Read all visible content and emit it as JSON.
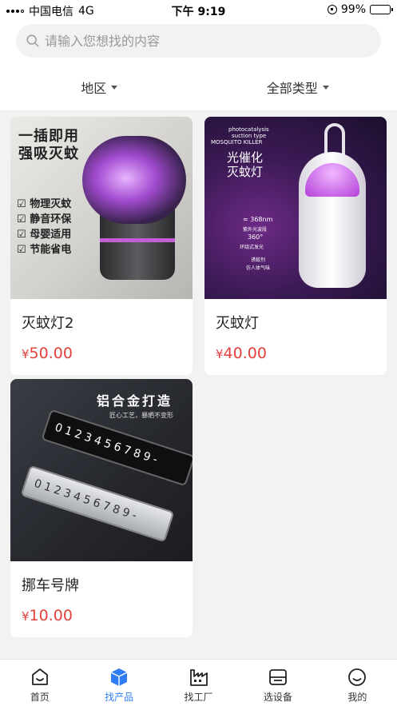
{
  "status_bar": {
    "carrier": "中国电信",
    "network": "4G",
    "time": "下午 9:19",
    "battery_percent": "99%",
    "battery_level": 0.99
  },
  "search": {
    "placeholder": "请输入您想找的内容",
    "value": ""
  },
  "filters": [
    {
      "label": "地区"
    },
    {
      "label": "全部类型"
    }
  ],
  "products": [
    {
      "title": "灭蚊灯2",
      "price": "50.00",
      "currency": "¥",
      "image": {
        "headline": [
          "一插即用",
          "强吸灭蚊"
        ],
        "features": [
          "物理灭蚊",
          "静音环保",
          "母婴适用",
          "节能省电"
        ]
      }
    },
    {
      "title": "灭蚊灯",
      "price": "40.00",
      "currency": "¥",
      "image": {
        "small": [
          "photocatalysis",
          "suction type",
          "MOSQUITO KILLER"
        ],
        "headline": [
          "光催化",
          "灭蚊灯"
        ],
        "specs": [
          "≈ 368nm",
          "紫外光波段",
          "360°",
          "环绕式发光",
          "诱蚊剂",
          "仿人体气味"
        ]
      }
    },
    {
      "title": "挪车号牌",
      "price": "10.00",
      "currency": "¥",
      "image": {
        "headline": "铝合金打造",
        "sub": "匠心工艺，暴晒不变形",
        "plate_digits": "0123456789-"
      }
    }
  ],
  "tabbar": [
    {
      "label": "首页",
      "icon": "home-face-icon",
      "active": false
    },
    {
      "label": "找产品",
      "icon": "cube-icon",
      "active": true
    },
    {
      "label": "找工厂",
      "icon": "factory-icon",
      "active": false
    },
    {
      "label": "选设备",
      "icon": "device-icon",
      "active": false
    },
    {
      "label": "我的",
      "icon": "smile-face-icon",
      "active": false
    }
  ],
  "colors": {
    "accent": "#2f7cf6",
    "price": "#e2403c",
    "background": "#f2f2f2"
  }
}
